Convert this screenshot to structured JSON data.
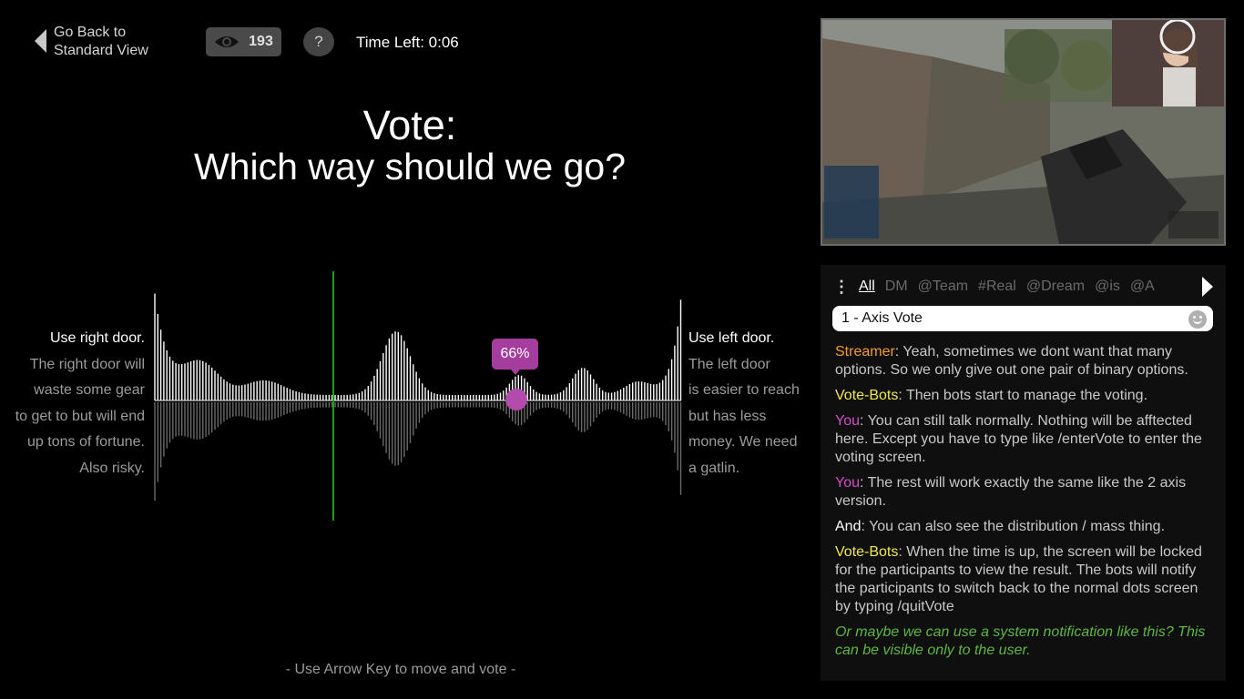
{
  "header": {
    "back_line1": "Go Back to",
    "back_line2": "Standard View",
    "viewer_count": "193",
    "help_label": "?",
    "timer": "Time Left: 0:06"
  },
  "vote": {
    "title_line1": "Vote:",
    "title_line2": "Which way should we go?",
    "percent": "66%",
    "percent_value": 0.66,
    "hint": "- Use Arrow Key to move and vote -",
    "left_option": {
      "title": "Use right door.",
      "desc_lines": [
        "The right door will",
        "waste some gear",
        "to get to but will end",
        "up tons of fortune.",
        "Also risky."
      ]
    },
    "right_option": {
      "title": "Use left door.",
      "desc_lines": [
        "The left door",
        "is easier to reach",
        "but has less",
        "money. We need",
        "a gatlin."
      ]
    }
  },
  "chat": {
    "tabs": [
      "All",
      "DM",
      "@Team",
      "#Real",
      "@Dream",
      "@is",
      "@A"
    ],
    "active_tab": "All",
    "input_value": "1 - Axis Vote",
    "messages": [
      {
        "user": "Streamer",
        "color": "#f39c2c",
        "text": ": Yeah, sometimes we dont want that many options. So we only give out one pair of binary options."
      },
      {
        "user": "Vote-Bots",
        "color": "#f2ea4a",
        "text": ": Then bots start to manage the voting."
      },
      {
        "user": "You",
        "color": "#d34ec9",
        "text": ": You  can still talk normally. Nothing will be afftected here. Except you have to type like /enterVote to enter the voting screen."
      },
      {
        "user": "You",
        "color": "#d34ec9",
        "text": ": The rest will work exactly the same like the 2 axis version."
      },
      {
        "user": "And",
        "color": "#ffffff",
        "text": ": You can also see the distribution / mass thing."
      },
      {
        "user": "Vote-Bots",
        "color": "#f2ea4a",
        "text": ": When the time is up, the screen will be locked for the participants to view the result. The bots will notify the  participants to switch back to the normal dots screen by typing /quitVote"
      }
    ],
    "notice": "Or maybe we can use a system notification like this? This can be visible only to the user."
  },
  "icons": {
    "back": "caret-left-icon",
    "viewers": "eye-icon",
    "menu": "vertical-dots-icon",
    "next": "caret-right-icon",
    "emoji": "smiley-icon"
  },
  "colors": {
    "accent": "#a53d9f",
    "marker": "#18a01a"
  }
}
